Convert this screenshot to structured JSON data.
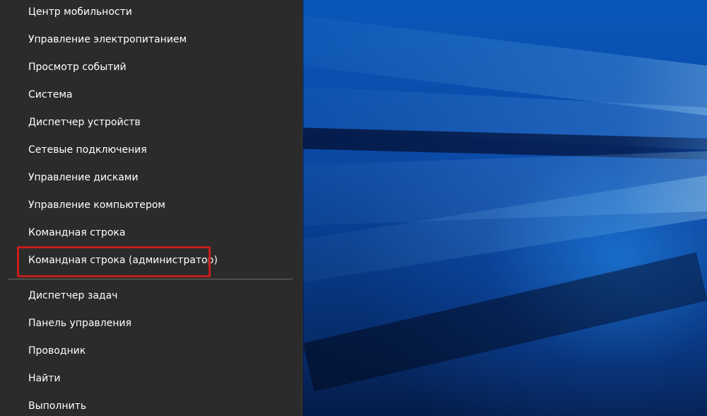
{
  "menu": {
    "items_top": [
      "Центр мобильности",
      "Управление электропитанием",
      "Просмотр событий",
      "Система",
      "Диспетчер устройств",
      "Сетевые подключения",
      "Управление дисками",
      "Управление компьютером",
      "Командная строка",
      "Командная строка (администратор)"
    ],
    "items_bottom": [
      "Диспетчер задач",
      "Панель управления",
      "Проводник",
      "Найти",
      "Выполнить"
    ]
  },
  "colors": {
    "menu_background": "#2b2b2b",
    "menu_text": "#ffffff",
    "highlight_frame": "#c51d1d",
    "separator": "#6b6b6b",
    "wallpaper_accent": "#0a57b8"
  }
}
